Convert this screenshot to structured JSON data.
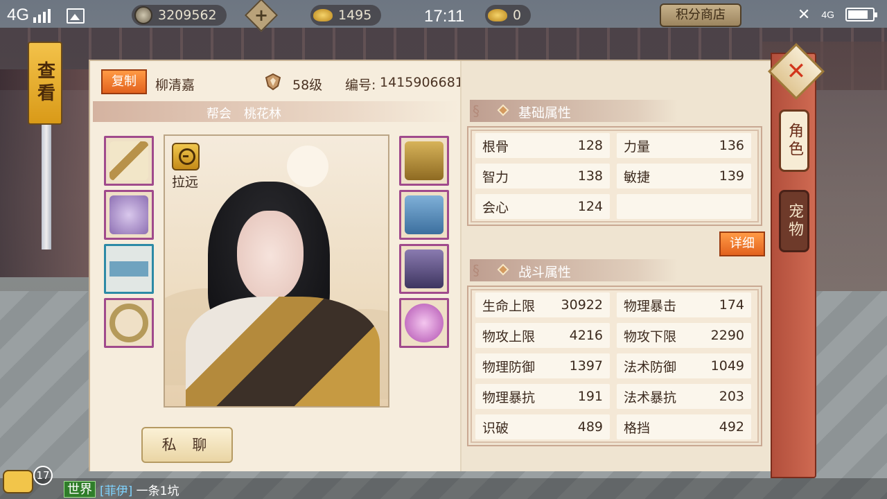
{
  "status_bar": {
    "network": "4G",
    "time": "17:11",
    "right_network": "4G"
  },
  "currencies": {
    "copper": "3209562",
    "gold": "1495",
    "ingot": "0"
  },
  "shop_button": "积分商店",
  "view_banner": "查看",
  "player": {
    "copy_label": "复制",
    "name": "柳清嘉",
    "level": "58级",
    "id_label": "编号:",
    "id_value": "1415906681",
    "guild_label": "帮会",
    "guild_name": "桃花林"
  },
  "portrait": {
    "zoom_label": "拉远"
  },
  "equipment_left": [
    "weapon",
    "robe",
    "belt",
    "ring"
  ],
  "equipment_right": [
    "helmet",
    "pants",
    "boots",
    "pendant"
  ],
  "chat_button": "私 聊",
  "basic_attrs": {
    "title": "基础属性",
    "rows": [
      {
        "name": "根骨",
        "value": "128"
      },
      {
        "name": "力量",
        "value": "136"
      },
      {
        "name": "智力",
        "value": "138"
      },
      {
        "name": "敏捷",
        "value": "139"
      },
      {
        "name": "会心",
        "value": "124"
      },
      {
        "name": "",
        "value": ""
      }
    ],
    "detail_label": "详细"
  },
  "combat_attrs": {
    "title": "战斗属性",
    "rows": [
      {
        "name": "生命上限",
        "value": "30922"
      },
      {
        "name": "物理暴击",
        "value": "174"
      },
      {
        "name": "物攻上限",
        "value": "4216"
      },
      {
        "name": "物攻下限",
        "value": "2290"
      },
      {
        "name": "物理防御",
        "value": "1397"
      },
      {
        "name": "法术防御",
        "value": "1049"
      },
      {
        "name": "物理暴抗",
        "value": "191"
      },
      {
        "name": "法术暴抗",
        "value": "203"
      },
      {
        "name": "识破",
        "value": "489"
      },
      {
        "name": "格挡",
        "value": "492"
      }
    ]
  },
  "side_tabs": {
    "role": "角色",
    "pet": "宠物"
  },
  "chat": {
    "unread": "17",
    "channel": "世界",
    "tag": "[菲伊]",
    "message": "一条1坑"
  },
  "colors": {
    "accent_orange": "#e2621e",
    "panel_bg": "#f3e9d8",
    "side_strip": "#b24f3c"
  }
}
